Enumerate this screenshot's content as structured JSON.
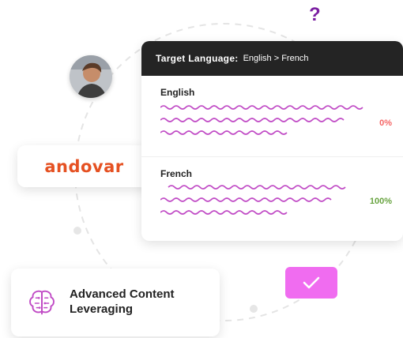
{
  "floating_symbol": "?",
  "andovar": {
    "logo_text": "andovar"
  },
  "translation_card": {
    "header_label": "Target Language:",
    "header_value": "English > French",
    "source_language": "English",
    "source_percent": "0%",
    "target_language": "French",
    "target_percent": "100%"
  },
  "feature": {
    "title": "Advanced Content Leveraging"
  },
  "colors": {
    "accent_purple": "#7b1fa2",
    "andovar_orange": "#e55122",
    "header_dark": "#242424",
    "wave_magenta": "#c04ac5",
    "percent_low": "#f56565",
    "percent_high": "#67a33f",
    "check_badge": "#f06cf0"
  },
  "icons": {
    "avatar": "person-photo",
    "feature": "brain-icon",
    "badge": "check-icon"
  }
}
